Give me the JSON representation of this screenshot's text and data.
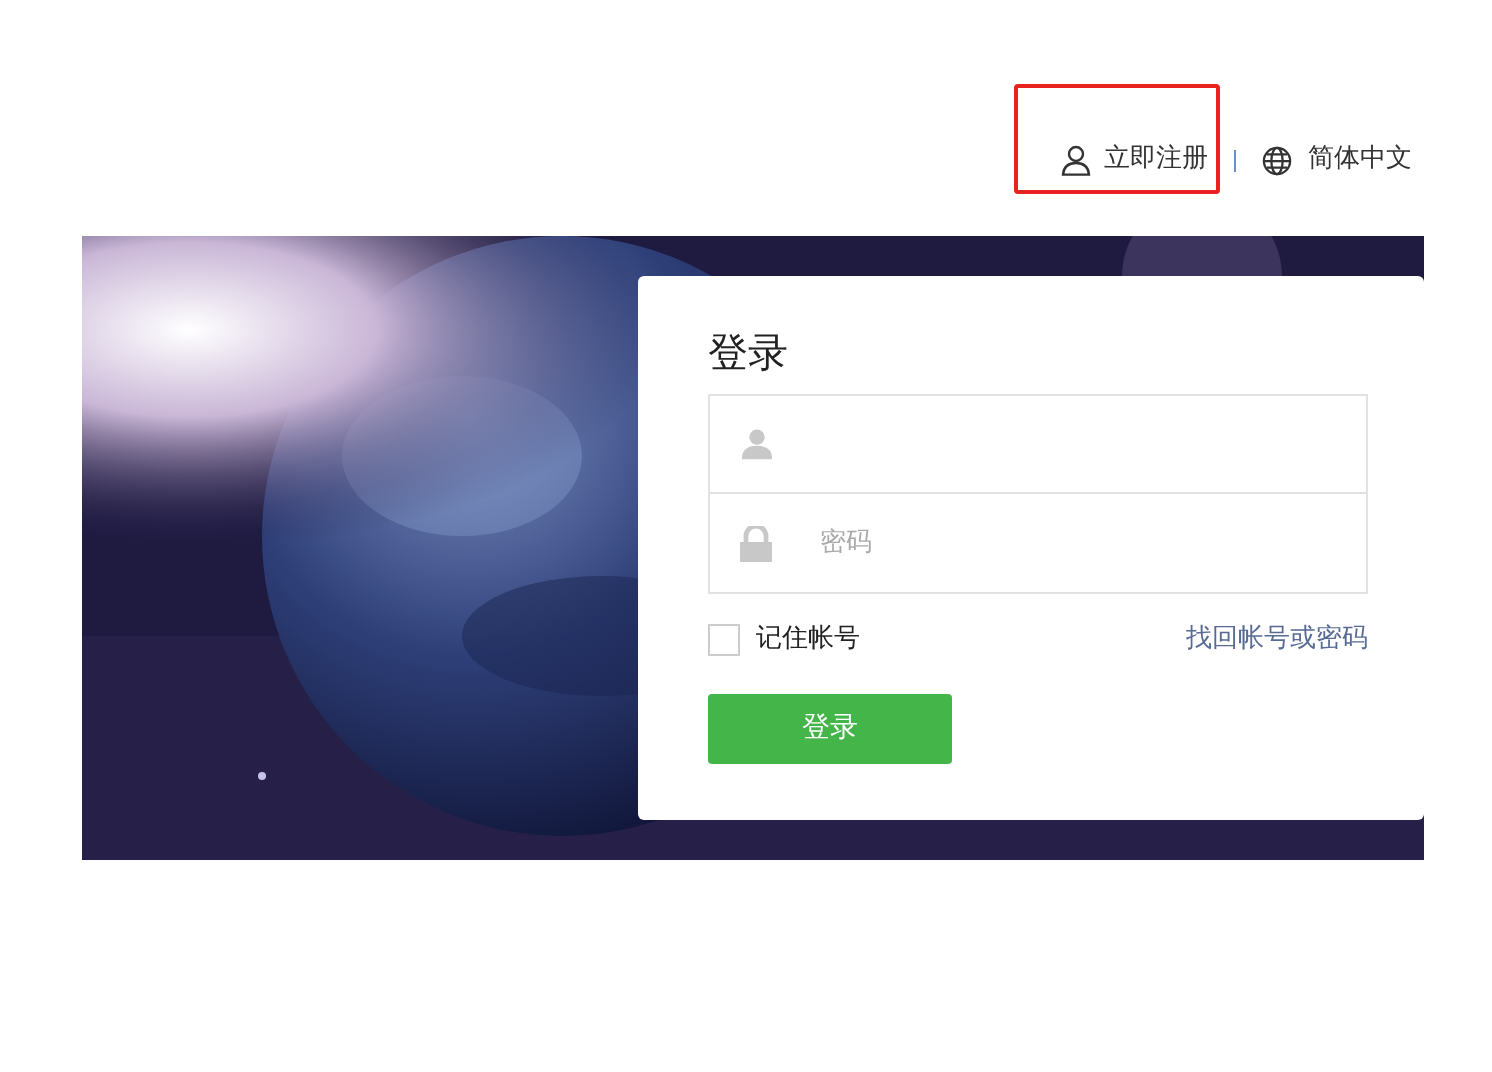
{
  "header": {
    "register": {
      "label": "立即注册",
      "highlighted": true
    },
    "language": "简体中文"
  },
  "login": {
    "title": "登录",
    "fields": [
      {
        "kind": "user"
      },
      {
        "kind": "password",
        "placeholder": "密码"
      }
    ],
    "remember": {
      "label": "记住帐号",
      "checked": false
    },
    "forgot_link": "找回帐号或密码",
    "submit": "登录"
  }
}
